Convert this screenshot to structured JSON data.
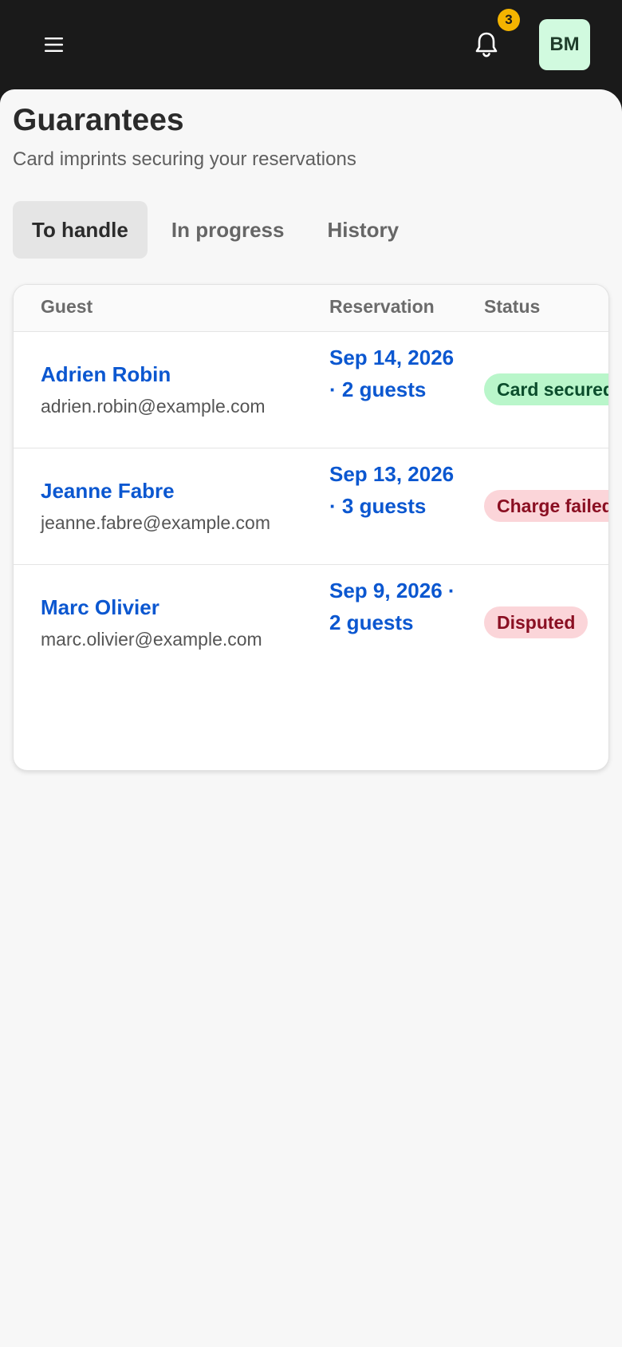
{
  "topbar": {
    "menu_icon": "hamburger-menu-icon",
    "bell_icon": "bell-icon",
    "notification_count": "3",
    "avatar_initials": "BM",
    "colors": {
      "bar_bg": "#1a1a1a",
      "badge_bg": "#f4b400",
      "avatar_bg": "#d1fadf"
    }
  },
  "page": {
    "title": "Guarantees",
    "subtitle": "Card imprints securing your reservations"
  },
  "tabs": [
    {
      "label": "To handle",
      "active": true
    },
    {
      "label": "In progress",
      "active": false
    },
    {
      "label": "History",
      "active": false
    }
  ],
  "table": {
    "headers": {
      "guest": "Guest",
      "reservation": "Reservation",
      "status": "Status"
    },
    "rows": [
      {
        "name": "Adrien Robin",
        "email": "adrien.robin@example.com",
        "reservation": "Sep 14, 2026 · 2 guests",
        "status": "Card secured",
        "status_bg": "#b9f6ca",
        "status_color": "#0b4d2c"
      },
      {
        "name": "Jeanne Fabre",
        "email": "jeanne.fabre@example.com",
        "reservation": "Sep 13, 2026 · 3 guests",
        "status": "Charge failed",
        "status_bg": "#fbd5d9",
        "status_color": "#8a0f22"
      },
      {
        "name": "Marc Olivier",
        "email": "marc.olivier@example.com",
        "reservation": "Sep 9, 2026 · 2 guests",
        "status": "Disputed",
        "status_bg": "#fbd5d9",
        "status_color": "#8a0f22"
      }
    ]
  }
}
